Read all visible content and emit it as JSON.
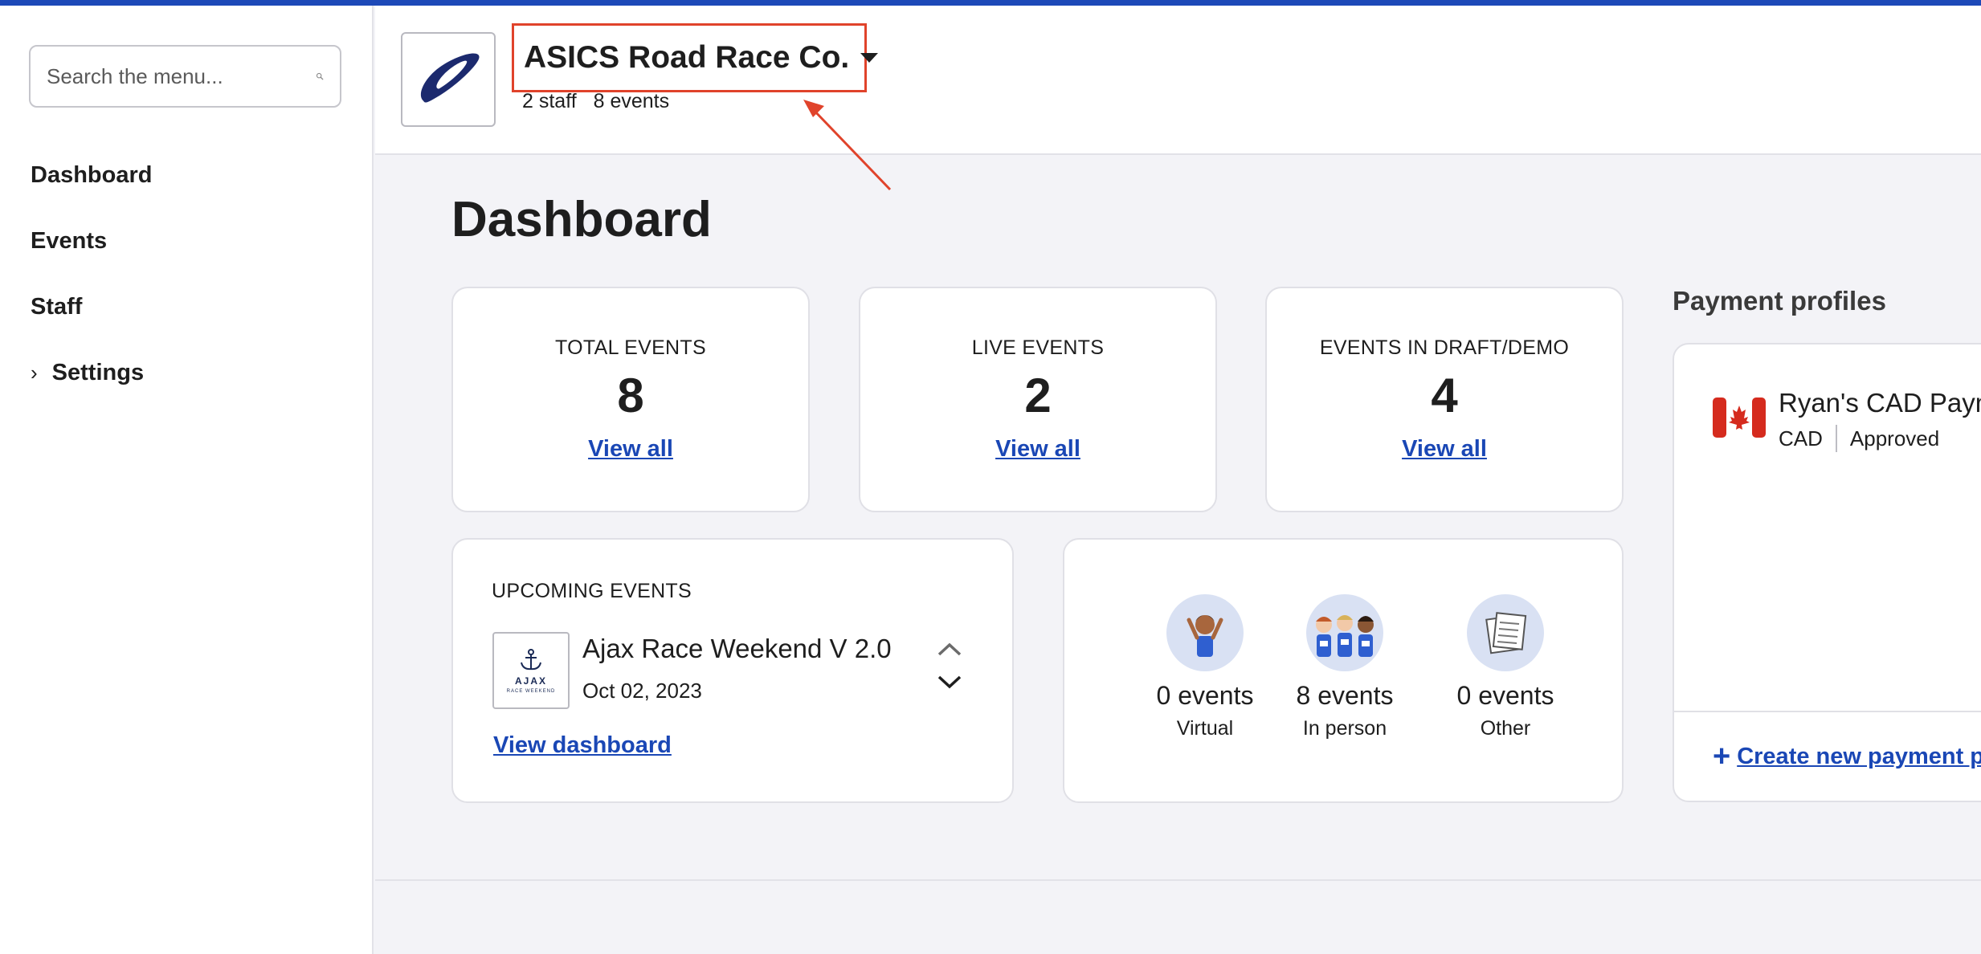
{
  "sidebar": {
    "search_placeholder": "Search the menu...",
    "items": [
      {
        "label": "Dashboard"
      },
      {
        "label": "Events"
      },
      {
        "label": "Staff"
      },
      {
        "label": "Settings",
        "chevron": "›"
      }
    ]
  },
  "header": {
    "org_name": "ASICS Road Race Co.",
    "staff_count": "2 staff",
    "events_count": "8 events",
    "highlight_color": "#e0432b"
  },
  "main": {
    "title": "Dashboard",
    "stats": [
      {
        "label": "TOTAL EVENTS",
        "value": "8",
        "link": "View all"
      },
      {
        "label": "LIVE EVENTS",
        "value": "2",
        "link": "View all"
      },
      {
        "label": "EVENTS IN DRAFT/DEMO",
        "value": "4",
        "link": "View all"
      }
    ],
    "upcoming": {
      "label": "UPCOMING EVENTS",
      "thumb_title": "AJAX",
      "thumb_subtitle": "RACE WEEKEND",
      "event_name": "Ajax Race Weekend V 2.0",
      "event_date": "Oct 02, 2023",
      "link": "View dashboard"
    },
    "event_types": [
      {
        "count": "0 events",
        "label": "Virtual",
        "icon": "runner-icon"
      },
      {
        "count": "8 events",
        "label": "In person",
        "icon": "group-runners-icon"
      },
      {
        "count": "0 events",
        "label": "Other",
        "icon": "documents-icon"
      }
    ]
  },
  "payment_profiles": {
    "heading": "Payment profiles",
    "profile_name": "Ryan's CAD Paym",
    "currency": "CAD",
    "status": "Approved",
    "create_link": "Create new payment p"
  },
  "colors": {
    "accent": "#1d49b8",
    "link": "#1a47b5",
    "background": "#f3f3f7"
  }
}
